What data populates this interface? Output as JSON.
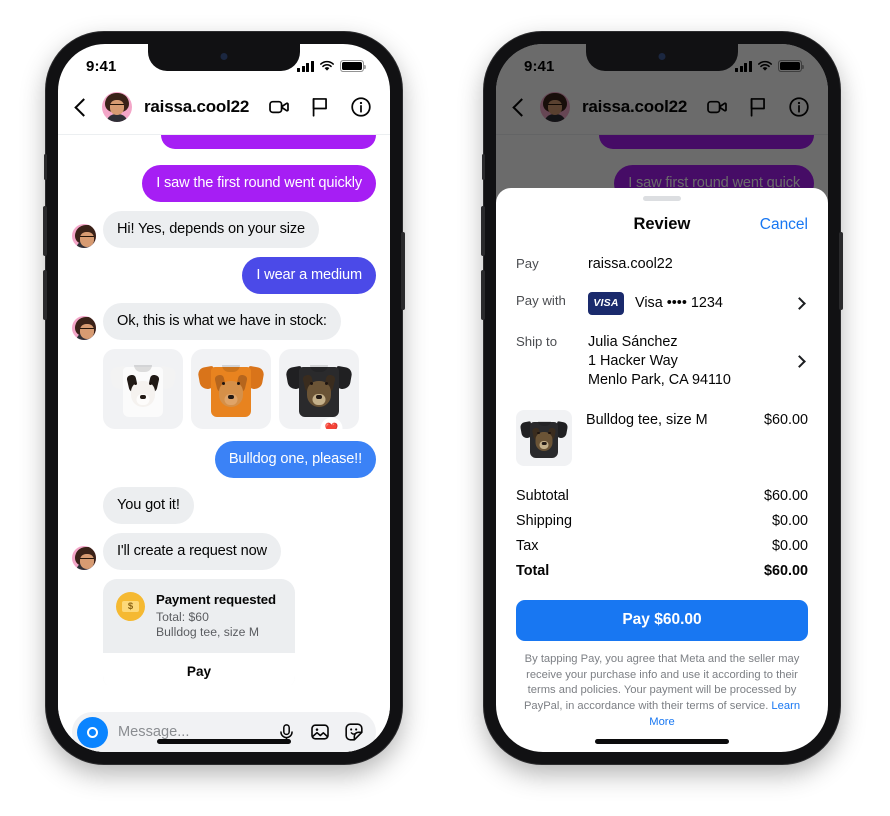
{
  "status_bar": {
    "time": "9:41",
    "signal_icon": "cellular-bars-icon",
    "wifi_icon": "wifi-icon",
    "battery_icon": "battery-icon"
  },
  "chat": {
    "header": {
      "back_icon": "back-chevron-icon",
      "avatar": "user-avatar",
      "name": "raissa.cool22",
      "video_icon": "video-camera-icon",
      "flag_icon": "flag-icon",
      "info_icon": "info-circle-icon"
    },
    "messages": [
      {
        "id": "m0",
        "text": "",
        "side": "out",
        "style": "purple",
        "clipped": true
      },
      {
        "id": "m1",
        "text": "I saw the first round went quickly",
        "side": "out",
        "style": "purple"
      },
      {
        "id": "m2",
        "text": "Hi! Yes, depends on your size",
        "side": "in",
        "style": "grey"
      },
      {
        "id": "m3",
        "text": "I wear a medium",
        "side": "out",
        "style": "indigo"
      },
      {
        "id": "m4",
        "text": "Ok, this is what we have in stock:",
        "side": "in",
        "style": "grey"
      }
    ],
    "carousel": {
      "items": [
        {
          "name": "border-collie-tee",
          "shirt_color": "#ffffff",
          "shirt_shade": "#ececec"
        },
        {
          "name": "golden-retriever-tee",
          "shirt_color": "#e8831f",
          "shirt_shade": "#cf7015"
        },
        {
          "name": "bulldog-tee",
          "shirt_color": "#2a2a2c",
          "shirt_shade": "#1a1a1c"
        }
      ],
      "reaction": "❤️"
    },
    "messages_after": [
      {
        "id": "m5",
        "text": "Bulldog one, please!!",
        "side": "out",
        "style": "blue"
      },
      {
        "id": "m6",
        "text": "You got it!",
        "side": "in",
        "style": "grey"
      },
      {
        "id": "m7",
        "text": "I'll create a request now",
        "side": "in",
        "style": "grey"
      }
    ],
    "payment_card": {
      "icon": "money-bill-icon",
      "icon_glyph": "$",
      "title": "Payment requested",
      "total": "Total: $60",
      "item": "Bulldog tee, size M",
      "action": "Pay"
    },
    "composer": {
      "camera_icon": "camera-icon",
      "placeholder": "Message...",
      "mic_icon": "microphone-icon",
      "gallery_icon": "photo-gallery-icon",
      "sticker_icon": "sticker-icon"
    }
  },
  "checkout": {
    "behind_messages": [
      {
        "id": "d0",
        "text": "",
        "clipped": true
      },
      {
        "id": "d1",
        "text": "I saw first round went quick"
      }
    ],
    "sheet": {
      "grab_handle": "sheet-grab-handle",
      "title": "Review",
      "cancel": "Cancel",
      "rows": [
        {
          "label": "Pay",
          "value": "raissa.cool22",
          "chevron": false
        },
        {
          "label": "Pay with",
          "value": "Visa •••• 1234",
          "badge": "VISA",
          "chevron": true
        },
        {
          "label": "Ship to",
          "value": "Julia Sánchez\n1 Hacker Way\nMenlo Park, CA 94110",
          "chevron": true
        }
      ],
      "item": {
        "thumb": "bulldog-tee-thumbnail",
        "name": "Bulldog tee, size M",
        "price": "$60.00"
      },
      "totals": [
        {
          "label": "Subtotal",
          "value": "$60.00",
          "bold": false
        },
        {
          "label": "Shipping",
          "value": "$0.00",
          "bold": false
        },
        {
          "label": "Tax",
          "value": "$0.00",
          "bold": false
        },
        {
          "label": "Total",
          "value": "$60.00",
          "bold": true
        }
      ],
      "pay_button": "Pay $60.00",
      "legal": "By tapping Pay, you agree that Meta and the seller may receive your purchase info and use it according to their terms and policies. Your payment will be processed by PayPal, in accordance with their terms of service.",
      "learn_more": "Learn More"
    }
  },
  "colors": {
    "purple": "#a61ef4",
    "indigo": "#4b4ae8",
    "blue": "#3b82f6",
    "bubble_grey": "#eceef0",
    "link_blue": "#1877f2",
    "visa_navy": "#1a2a6c",
    "coin_yellow": "#f5b932"
  }
}
